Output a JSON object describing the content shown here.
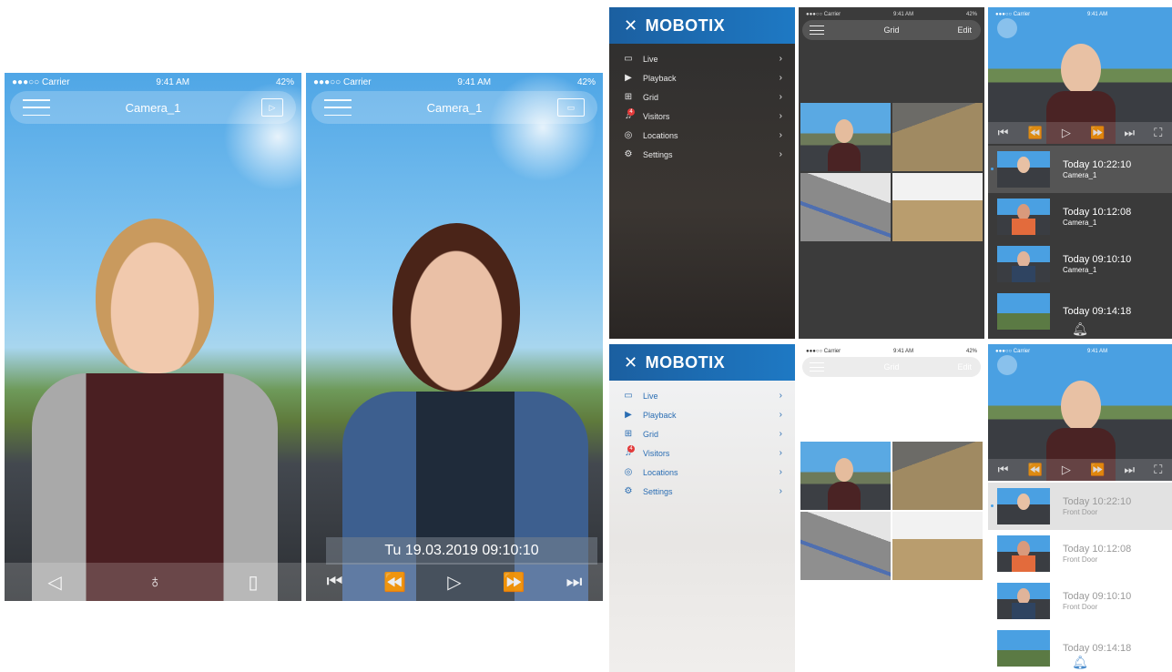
{
  "status": {
    "carrier": "●●●○○ Carrier",
    "time": "9:41 AM",
    "battery1": "42%",
    "battery2": "42%"
  },
  "live": {
    "title": "Camera_1"
  },
  "playback": {
    "title": "Camera_1",
    "timestamp": "Tu 19.03.2019 09:10:10"
  },
  "menu": {
    "brand": "MOBOTIX",
    "close_glyph": "✕",
    "items": [
      {
        "label": "Live",
        "icon": "camera-icon"
      },
      {
        "label": "Playback",
        "icon": "play-icon"
      },
      {
        "label": "Grid",
        "icon": "grid-icon"
      },
      {
        "label": "Visitors",
        "icon": "bell-icon",
        "badge": "4"
      },
      {
        "label": "Locations",
        "icon": "location-icon"
      },
      {
        "label": "Settings",
        "icon": "gear-icon"
      }
    ]
  },
  "grid": {
    "title": "Grid",
    "edit": "Edit"
  },
  "visitors_dark": [
    {
      "time": "Today 10:22:10",
      "camera": "Camera_1"
    },
    {
      "time": "Today 10:12:08",
      "camera": "Camera_1"
    },
    {
      "time": "Today 09:10:10",
      "camera": "Camera_1"
    },
    {
      "time": "Today 09:14:18",
      "camera": ""
    }
  ],
  "visitors_light": [
    {
      "time": "Today 10:22:10",
      "camera": "Front Door"
    },
    {
      "time": "Today 10:12:08",
      "camera": "Front Door"
    },
    {
      "time": "Today 09:10:10",
      "camera": "Front Door"
    },
    {
      "time": "Today 09:14:18",
      "camera": ""
    }
  ],
  "colors": {
    "dark_bg": "#3a3a3a",
    "menu_blue": "#1c6fb3",
    "selected_row": "#dcdcdc"
  }
}
